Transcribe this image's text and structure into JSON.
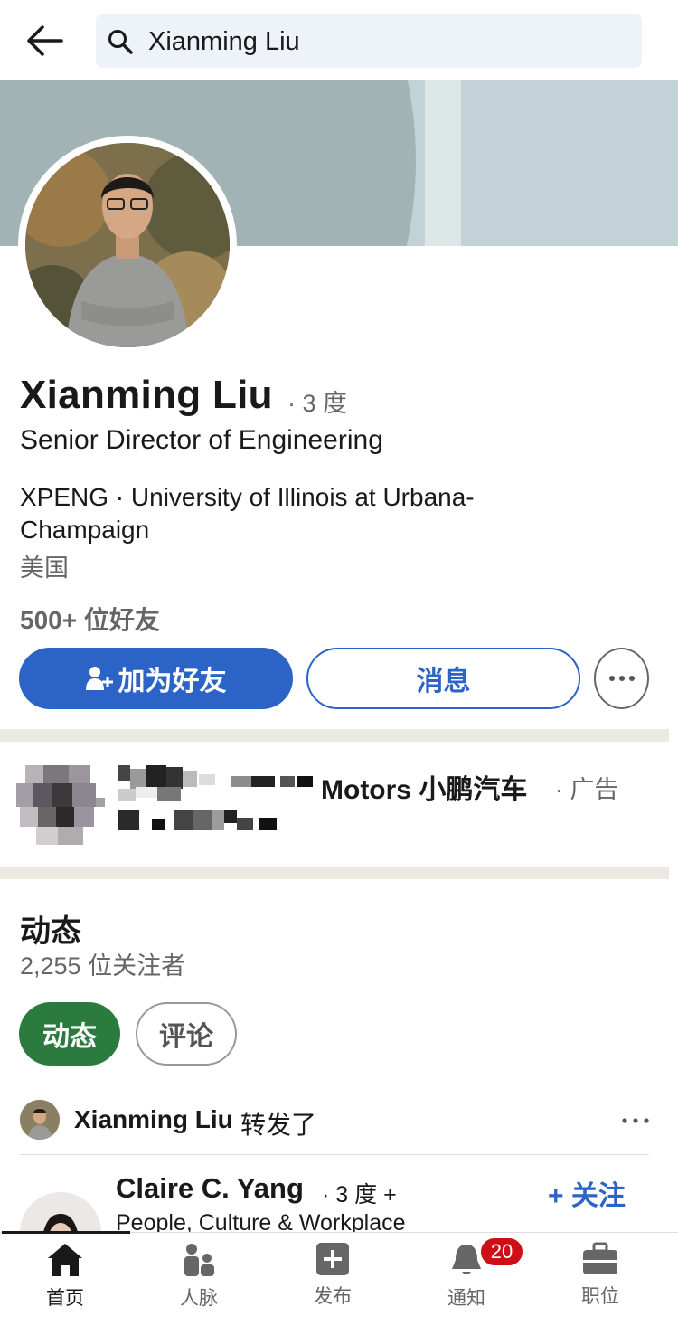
{
  "search": {
    "query": "Xianming Liu"
  },
  "profile": {
    "name": "Xianming Liu",
    "degree": "· 3 度",
    "headline": "Senior Director of Engineering",
    "orgs": "XPENG · University of Illinois at Urbana-Champaign",
    "location": "美国",
    "connections": "500+ 位好友"
  },
  "actions": {
    "add_friend": "加为好友",
    "message": "消息"
  },
  "ad": {
    "advertiser": "Motors 小鹏汽车",
    "tag": "· 广告"
  },
  "activity": {
    "title": "动态",
    "followers": "2,255 位关注者",
    "tabs": [
      {
        "label": "动态",
        "active": true
      },
      {
        "label": "评论",
        "active": false
      }
    ],
    "repost": {
      "actor": "Xianming Liu",
      "verb": "转发了"
    },
    "post": {
      "author": "Claire C. Yang",
      "degree": "· 3 度 +",
      "follow": "+ 关注",
      "subtitle": "People, Culture & Workplace"
    }
  },
  "nav": {
    "items": [
      {
        "label": "首页",
        "icon": "home-icon",
        "active": true
      },
      {
        "label": "人脉",
        "icon": "network-icon",
        "active": false
      },
      {
        "label": "发布",
        "icon": "post-icon",
        "active": false
      },
      {
        "label": "通知",
        "icon": "bell-icon",
        "active": false,
        "badge": "20"
      },
      {
        "label": "职位",
        "icon": "briefcase-icon",
        "active": false
      }
    ]
  },
  "colors": {
    "primary": "#2b64c6",
    "activity_tab": "#2b7b3f",
    "badge": "#cc1016"
  }
}
